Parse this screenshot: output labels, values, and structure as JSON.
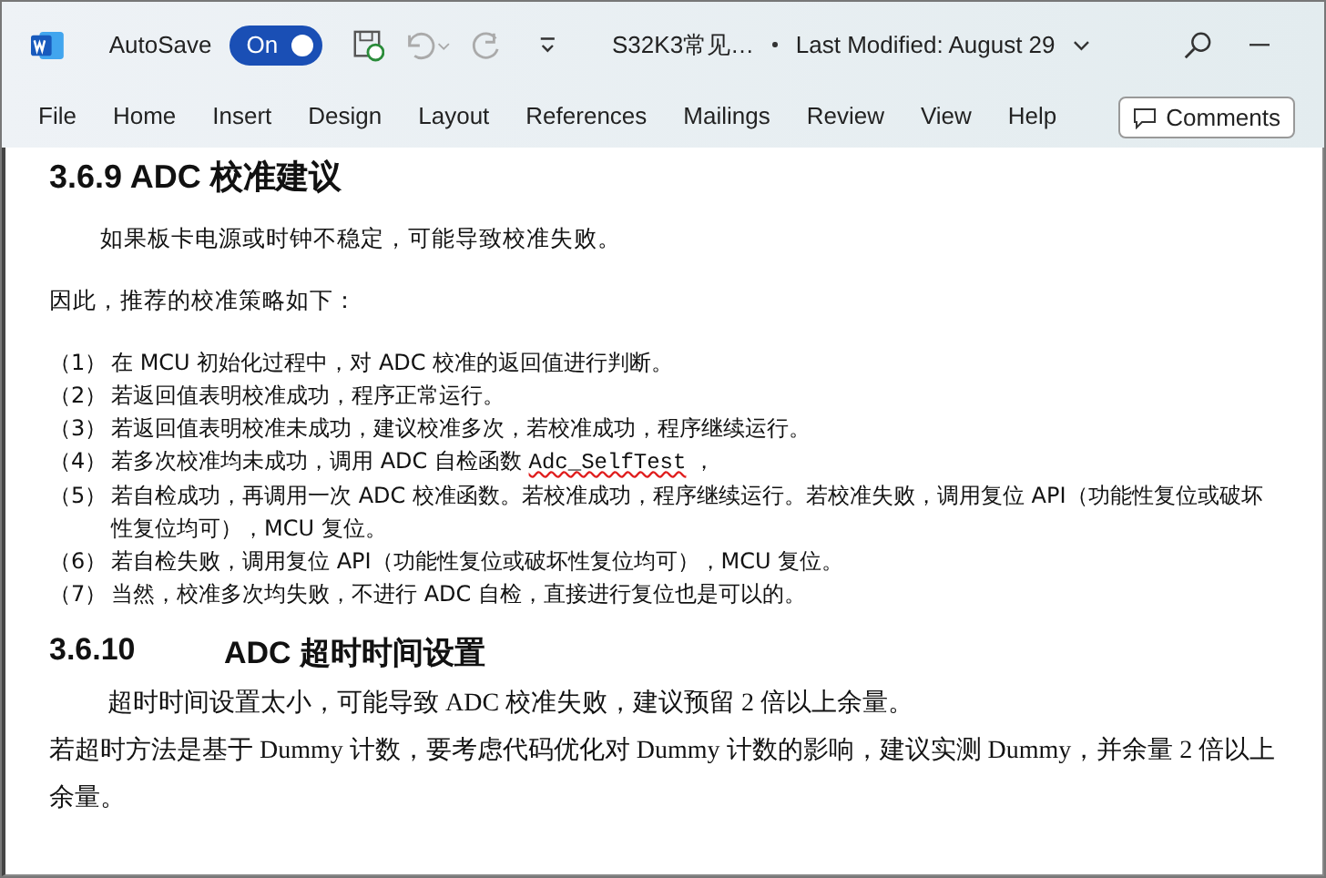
{
  "titlebar": {
    "autosave_label": "AutoSave",
    "autosave": {
      "label": "On",
      "on": true
    },
    "undo_disabled": true,
    "redo_disabled": true,
    "doc_title": "S32K3常见…",
    "modified": "Last Modified: August 29"
  },
  "ribbon_tabs": [
    {
      "label": "File",
      "selected": false
    },
    {
      "label": "Home",
      "selected": false
    },
    {
      "label": "Insert",
      "selected": false
    },
    {
      "label": "Design",
      "selected": false
    },
    {
      "label": "Layout",
      "selected": false
    },
    {
      "label": "References",
      "selected": false
    },
    {
      "label": "Mailings",
      "selected": false
    },
    {
      "label": "Review",
      "selected": false
    },
    {
      "label": "View",
      "selected": false
    },
    {
      "label": "Help",
      "selected": false
    }
  ],
  "comments_button": "Comments",
  "document": [
    {
      "kind": "heading",
      "number": "3.6.9",
      "text": "ADC 校准建议"
    },
    {
      "kind": "indent",
      "text": "如果板卡电源或时钟不稳定，可能导致校准失败。"
    },
    {
      "kind": "para",
      "text": "因此，推荐的校准策略如下："
    },
    {
      "kind": "list",
      "items": [
        {
          "marker": "（1）",
          "segments": [
            {
              "kind": "text",
              "text": "在 MCU 初始化过程中，对 ADC 校准的返回值进行判断。"
            }
          ]
        },
        {
          "marker": "（2）",
          "segments": [
            {
              "kind": "text",
              "text": "若返回值表明校准成功，程序正常运行。"
            }
          ]
        },
        {
          "marker": "（3）",
          "segments": [
            {
              "kind": "text",
              "text": "若返回值表明校准未成功，建议校准多次，若校准成功，程序继续运行。"
            }
          ]
        },
        {
          "marker": "（4）",
          "segments": [
            {
              "kind": "text",
              "text": "若多次校准均未成功，调用 ADC 自检函数 "
            },
            {
              "kind": "misspelled",
              "text": "Adc_SelfTest"
            },
            {
              "kind": "text",
              "text": " ，"
            }
          ]
        },
        {
          "marker": "（5）",
          "segments": [
            {
              "kind": "text",
              "text": "若自检成功，再调用一次 ADC 校准函数。若校准成功，程序继续运行。若校准失败，调用复位 API（功能性复位或破坏性复位均可），MCU 复位。"
            }
          ]
        },
        {
          "marker": "（6）",
          "segments": [
            {
              "kind": "text",
              "text": "若自检失败，调用复位 API（功能性复位或破坏性复位均可），MCU 复位。"
            }
          ]
        },
        {
          "marker": "（7）",
          "segments": [
            {
              "kind": "text",
              "text": "当然，校准多次均失败，不进行 ADC 自检，直接进行复位也是可以的。"
            }
          ]
        }
      ]
    },
    {
      "kind": "heading2",
      "number": "3.6.10",
      "text": "ADC 超时时间设置"
    },
    {
      "kind": "body_indent",
      "text": "超时时间设置太小，可能导致 ADC 校准失败，建议预留 2 倍以上余量。"
    },
    {
      "kind": "body",
      "text": "若超时方法是基于 Dummy 计数，要考虑代码优化对 Dummy 计数的影响，建议实测 Dummy，并余量 2 倍以上余量。"
    }
  ]
}
